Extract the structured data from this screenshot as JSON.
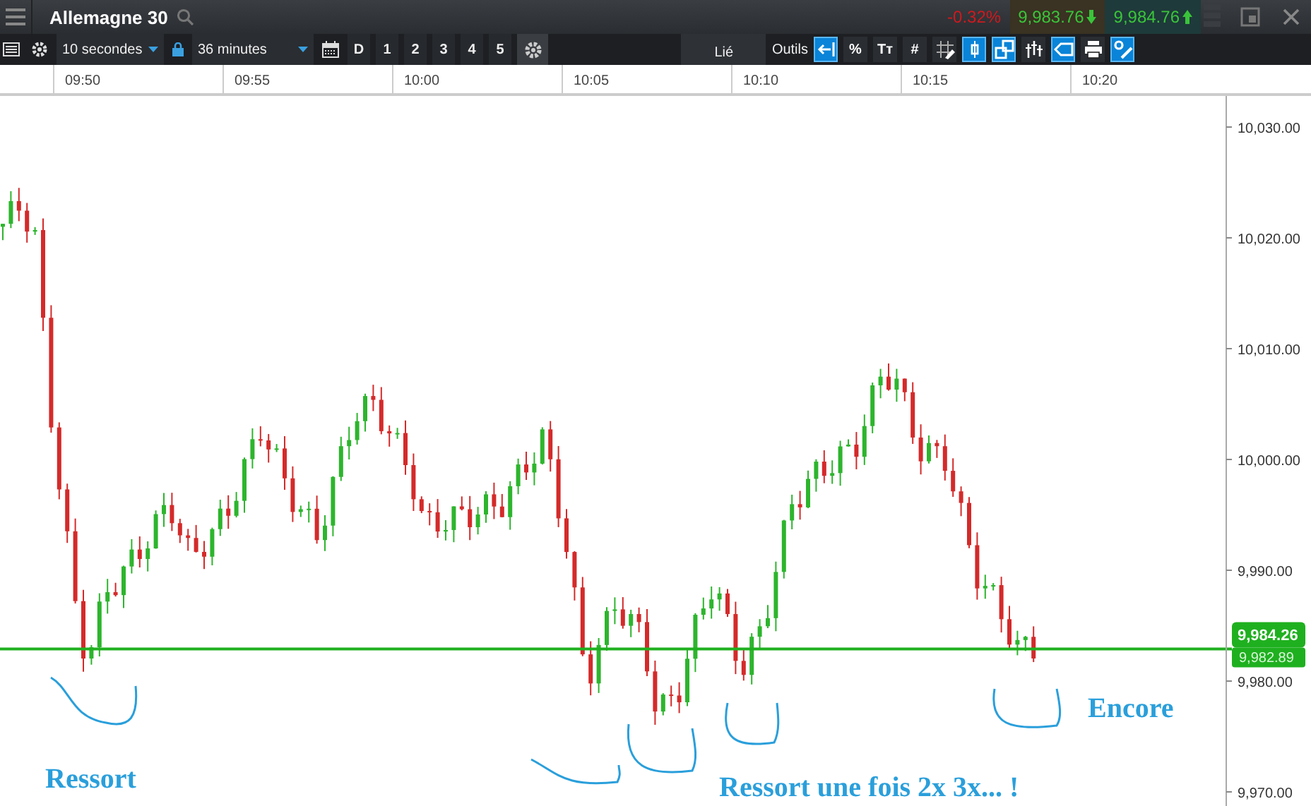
{
  "header": {
    "title": "Allemagne 30",
    "change": "-0.32%",
    "sell_price": "9,983.76",
    "buy_price": "9,984.76"
  },
  "toolbar": {
    "interval": "10 secondes",
    "range": "36 minutes",
    "period_buttons": [
      "D",
      "1",
      "2",
      "3",
      "4",
      "5"
    ],
    "linked": "Lié",
    "tools_label": "Outils",
    "tools": [
      {
        "selected": true
      },
      {
        "label": "%",
        "selected": false
      },
      {
        "label": "Tт",
        "selected": false
      },
      {
        "label": "#",
        "selected": false
      },
      {
        "selected": false
      },
      {
        "selected": true
      },
      {
        "selected": true
      },
      {
        "selected": false
      },
      {
        "selected": true
      },
      {
        "selected": false
      },
      {
        "selected": true
      }
    ]
  },
  "time_axis": [
    "09:50",
    "09:55",
    "10:00",
    "10:05",
    "10:10",
    "10:15",
    "10:20"
  ],
  "price_axis": [
    "10,030.00",
    "10,020.00",
    "10,010.00",
    "10,000.00",
    "9,990.00",
    "9,980.00",
    "9,970.00"
  ],
  "last_price": "9,984.26",
  "line_price": "9,982.89",
  "annotations": [
    "Ressort",
    "Ressort une fois 2x 3x... !",
    "Encore"
  ]
}
